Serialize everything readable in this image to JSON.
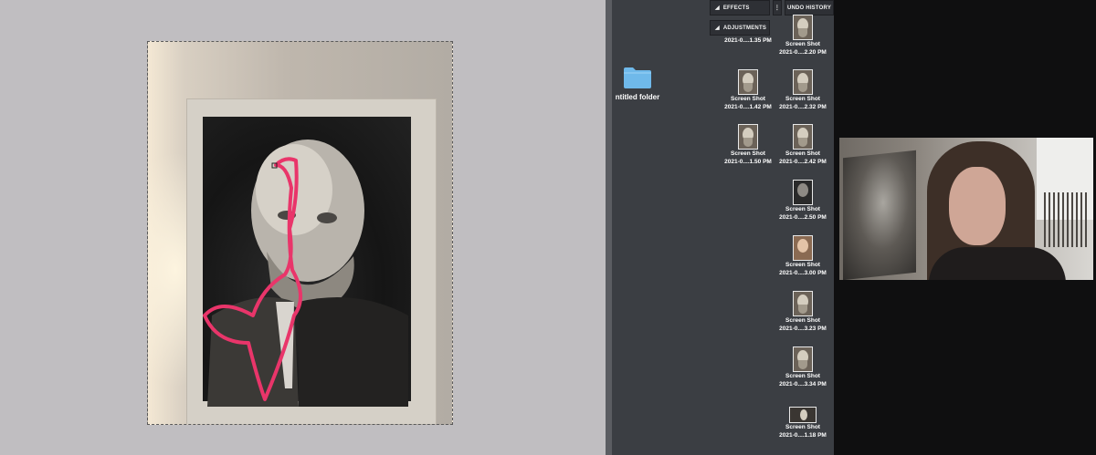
{
  "desktop": {
    "folder": {
      "label": "ntitled folder",
      "icon": "folder-icon",
      "color": "#6fb9ea"
    },
    "panel": {
      "effects_label": "EFFECTS",
      "adjustments_label": "ADJUSTMENTS",
      "undo_history_label": "UNDO HISTORY"
    },
    "files": [
      {
        "name": "",
        "date": "2021-0....1.35 PM"
      },
      {
        "name": "Screen Shot",
        "date": "2021-0....2.20 PM"
      },
      {
        "name": "Screen Shot",
        "date": "2021-0....1.42 PM"
      },
      {
        "name": "Screen Shot",
        "date": "2021-0....2.32 PM"
      },
      {
        "name": "Screen Shot",
        "date": "2021-0....1.50 PM"
      },
      {
        "name": "Screen Shot",
        "date": "2021-0....2.42 PM"
      },
      {
        "name": "Screen Shot",
        "date": "2021-0....2.50 PM"
      },
      {
        "name": "Screen Shot",
        "date": "2021-0....3.00 PM"
      },
      {
        "name": "Screen Shot",
        "date": "2021-0....3.23 PM"
      },
      {
        "name": "Screen Shot",
        "date": "2021-0....3.34 PM"
      },
      {
        "name": "Screen Shot",
        "date": "2021-0....1.18 PM"
      }
    ]
  },
  "colors": {
    "canvas_bg": "#c0bec1",
    "desktop_bg": "#3b3e43",
    "annotation_stroke": "#e9356a"
  }
}
